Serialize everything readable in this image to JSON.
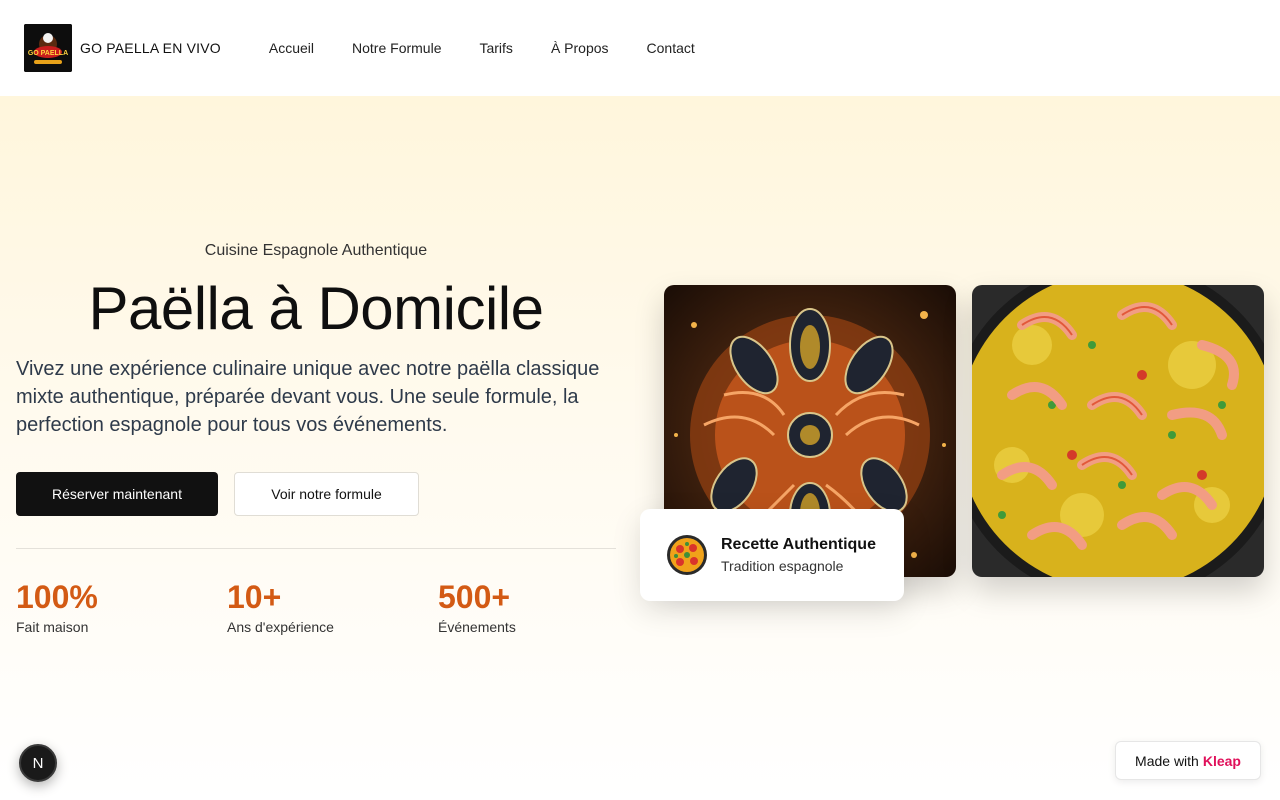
{
  "header": {
    "brand": "GO PAELLA EN VIVO",
    "logo_icon": "paella-chef-logo-icon",
    "nav": [
      "Accueil",
      "Notre Formule",
      "Tarifs",
      "À Propos",
      "Contact"
    ]
  },
  "hero": {
    "kicker": "Cuisine Espagnole Authentique",
    "title": "Paëlla à Domicile",
    "description": "Vivez une expérience culinaire unique avec notre paëlla classique mixte authentique, préparée devant vous. Une seule formule, la perfection espagnole pour tous vos événements.",
    "primary_button": "Réserver maintenant",
    "secondary_button": "Voir notre formule",
    "stats": [
      {
        "value": "100%",
        "label": "Fait maison"
      },
      {
        "value": "10+",
        "label": "Ans d'expérience"
      },
      {
        "value": "500+",
        "label": "Événements"
      }
    ],
    "accent_color": "#d35a14"
  },
  "recipe_card": {
    "icon": "paella-pan-icon",
    "title": "Recette Authentique",
    "subtitle": "Tradition espagnole"
  },
  "widgets": {
    "n_badge": "N",
    "made_with": "Made with",
    "made_with_brand": "Kleap",
    "brand_color": "#e0105a"
  }
}
